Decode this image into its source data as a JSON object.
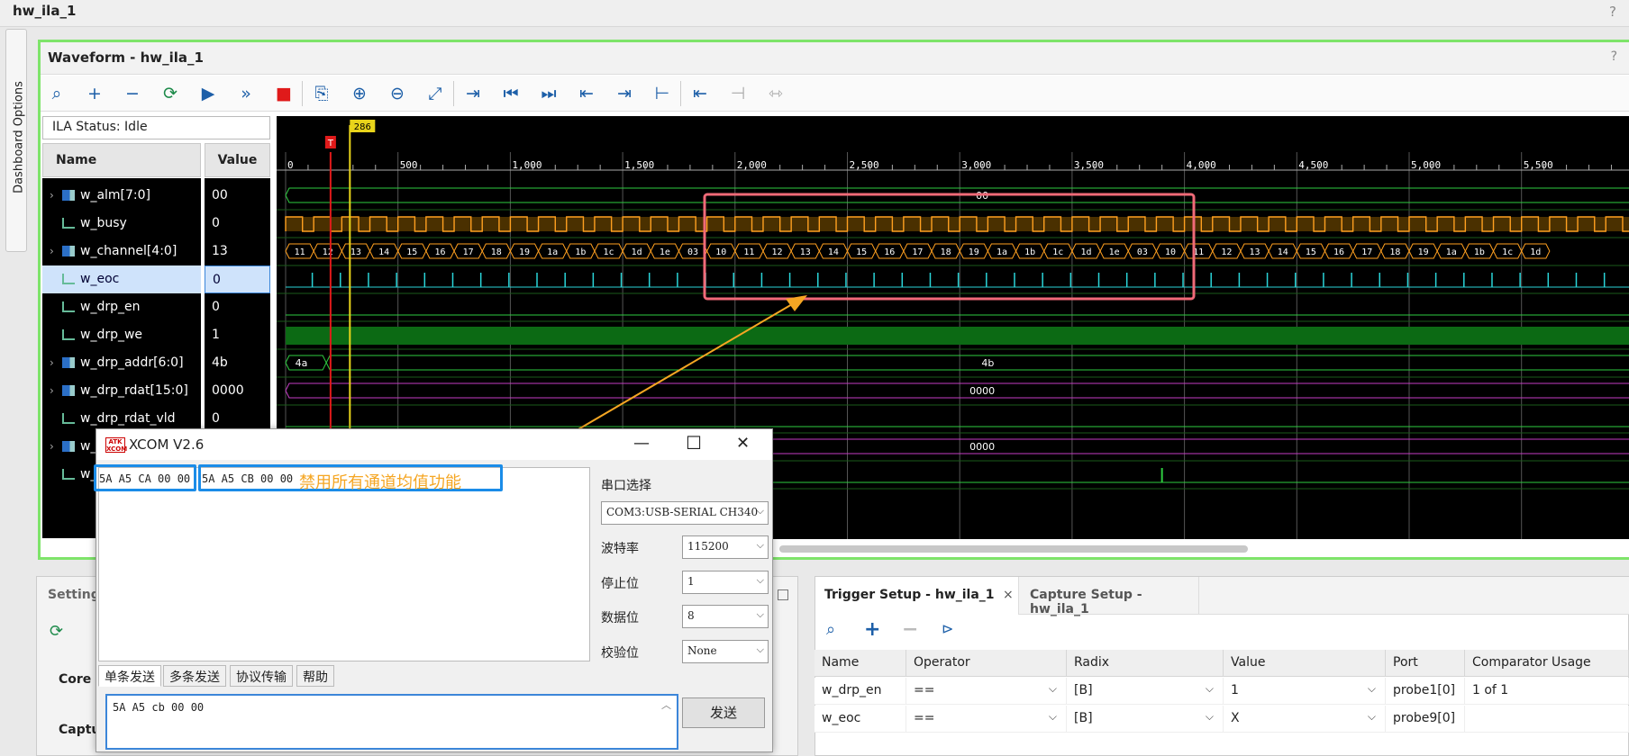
{
  "window": {
    "title": "hw_ila_1",
    "help": "?"
  },
  "dashboard_tab": "Dashboard Options",
  "waveform": {
    "title": "Waveform - hw_ila_1",
    "help": "?",
    "toolbar": [
      "search-icon",
      "add-icon",
      "remove-icon",
      "refresh-icon",
      "run-trigger-icon",
      "run-immediate-icon",
      "stop-icon",
      "export-icon",
      "zoom-in-icon",
      "zoom-out-icon",
      "zoom-fit-icon",
      "go-to-cursor-icon",
      "go-to-start-icon",
      "go-to-end-icon",
      "previous-transition-icon",
      "next-transition-icon",
      "add-marker-icon",
      "previous-marker-icon",
      "next-marker-icon",
      "swap-cursors-icon"
    ],
    "ila_status": "ILA Status: Idle",
    "col_name": "Name",
    "col_value": "Value",
    "cursor_label": "286",
    "trigger_label": "T",
    "ruler": [
      "0",
      "500",
      "1,000",
      "1,500",
      "2,000",
      "2,500",
      "3,000",
      "3,500",
      "4,000",
      "4,500",
      "5,000",
      "5,500"
    ],
    "signals": [
      {
        "name": "w_alm[7:0]",
        "value": "00",
        "bus": true
      },
      {
        "name": "w_busy",
        "value": "0",
        "bus": false
      },
      {
        "name": "w_channel[4:0]",
        "value": "13",
        "bus": true
      },
      {
        "name": "w_eoc",
        "value": "0",
        "bus": false,
        "selected": true
      },
      {
        "name": "w_drp_en",
        "value": "0",
        "bus": false
      },
      {
        "name": "w_drp_we",
        "value": "1",
        "bus": false
      },
      {
        "name": "w_drp_addr[6:0]",
        "value": "4b",
        "bus": true
      },
      {
        "name": "w_drp_rdat[15:0]",
        "value": "0000",
        "bus": true
      },
      {
        "name": "w_drp_rdat_vld",
        "value": "0",
        "bus": false
      },
      {
        "name": "w_",
        "value": "",
        "bus": true
      },
      {
        "name": "w_",
        "value": "",
        "bus": false
      }
    ],
    "bus_labels": {
      "alm": "00",
      "addr_first": "4a",
      "addr": "4b",
      "rdat": "0000",
      "row10": "0000"
    },
    "channel_seq": [
      "11",
      "12",
      "13",
      "14",
      "15",
      "16",
      "17",
      "18",
      "19",
      "1a",
      "1b",
      "1c",
      "1d",
      "1e",
      "03",
      "10",
      "11",
      "12",
      "13",
      "14",
      "15",
      "16",
      "17",
      "18",
      "19",
      "1a",
      "1b",
      "1c",
      "1d",
      "1e",
      "03",
      "10",
      "11",
      "12",
      "13",
      "14",
      "15",
      "16",
      "17",
      "18",
      "19",
      "1a",
      "1b",
      "1c",
      "1d"
    ]
  },
  "xcom": {
    "title": "XCOM V2.6",
    "logo": "ATK XCOM",
    "recv_part1": "5A A5 CA 00 00",
    "recv_part2": "5A A5 CB 00 00",
    "annotation": "禁用所有通道均值功能",
    "labels": {
      "port": "串口选择",
      "baud": "波特率",
      "stop": "停止位",
      "data": "数据位",
      "parity": "校验位"
    },
    "values": {
      "port": "COM3:USB-SERIAL CH340",
      "baud": "115200",
      "stop": "1",
      "data": "8",
      "parity": "None"
    },
    "tabs": [
      "单条发送",
      "多条发送",
      "协议传输",
      "帮助"
    ],
    "send_text": "5A A5 cb 00 00",
    "send_button": "发送"
  },
  "settings": {
    "title": "Settings",
    "core": "Core s",
    "capture": "Captu"
  },
  "trigger": {
    "tab_active": "Trigger Setup - hw_ila_1",
    "tab_inactive": "Capture Setup - hw_ila_1",
    "columns": [
      "Name",
      "Operator",
      "Radix",
      "Value",
      "Port",
      "Comparator Usage"
    ],
    "rows": [
      {
        "name": "w_drp_en",
        "operator": "==",
        "radix": "[B]",
        "value": "1",
        "port": "probe1[0]",
        "usage": "1 of 1"
      },
      {
        "name": "w_eoc",
        "operator": "==",
        "radix": "[B]",
        "value": "X",
        "port": "probe9[0]",
        "usage": ""
      }
    ]
  },
  "colors": {
    "accent_green": "#7ee46a",
    "highlight_red": "#f06a78",
    "annotation_orange": "#f5a623",
    "callout_blue": "#1a8ce8",
    "bus_orange": "#ffa020",
    "eoc_cyan": "#2ad4d8",
    "magenta": "#c43cc4"
  }
}
